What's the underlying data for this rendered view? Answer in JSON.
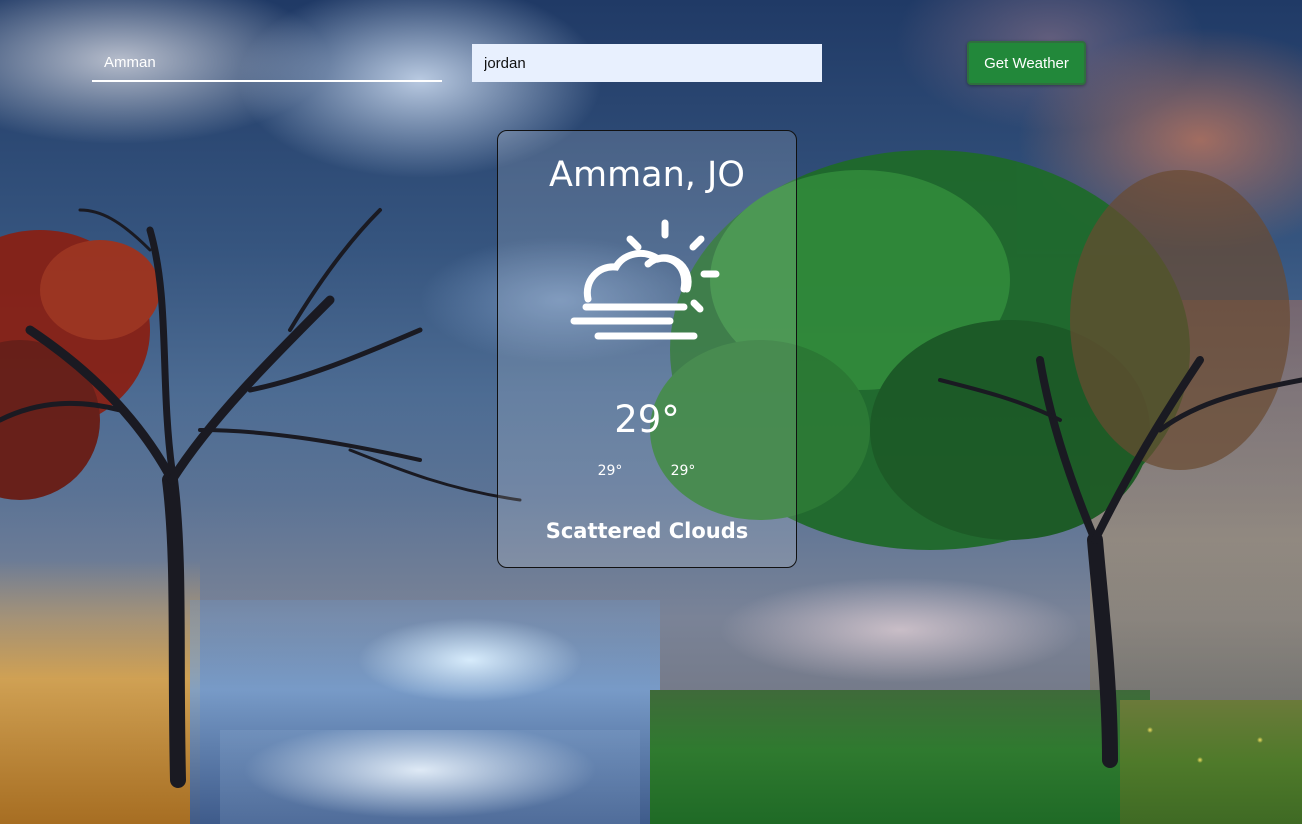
{
  "search": {
    "city_value": "Amman",
    "country_value": "jordan",
    "button_label": "Get Weather"
  },
  "weather": {
    "location": "Amman, JO",
    "icon": "sun-behind-cloud-fog-icon",
    "temperature": "29°",
    "temp_min": "29°",
    "temp_max": "29°",
    "description": "Scattered Clouds"
  },
  "colors": {
    "button_bg": "#22883a",
    "country_input_bg": "#e8f0fe",
    "text": "#ffffff"
  }
}
